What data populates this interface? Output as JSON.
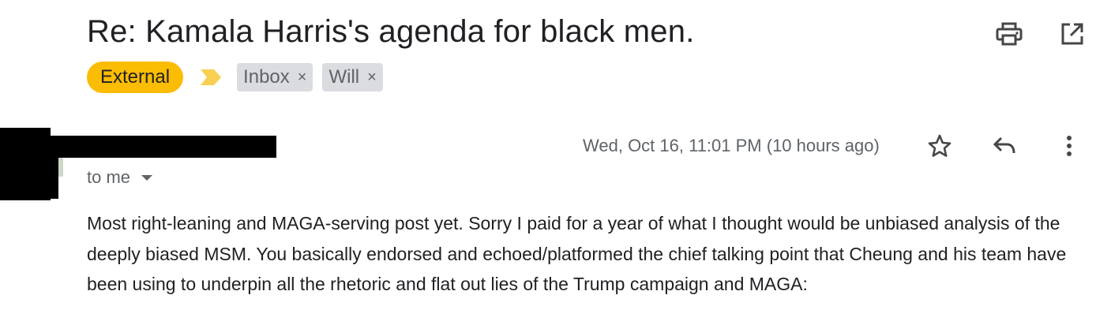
{
  "email": {
    "subject": "Re: Kamala Harris's agenda for black men.",
    "labels": {
      "external": "External",
      "importance_marker": "important-marker-icon",
      "chips": [
        {
          "label": "Inbox",
          "remove": "×"
        },
        {
          "label": "Will",
          "remove": "×"
        }
      ]
    },
    "recipient": "to me",
    "date": "Wed, Oct 16, 11:01 PM (10 hours ago)",
    "body": "Most right-leaning and MAGA-serving post yet. Sorry I paid for a year of what I thought would be unbiased analysis of the deeply biased MSM. You basically endorsed and echoed/platformed the chief talking point that Cheung and his team have been using to underpin all the rhetoric and flat out lies of the Trump campaign and MAGA:"
  },
  "icons": {
    "print": "print-icon",
    "open_new_window": "open-in-new-window-icon",
    "star": "star-icon",
    "reply": "reply-icon",
    "more": "more-vertical-icon"
  },
  "colors": {
    "external_chip": "#fbbc04",
    "importance_marker": "#f9cf52",
    "label_chip": "#dadce0",
    "secondary_text": "#5f6368"
  }
}
